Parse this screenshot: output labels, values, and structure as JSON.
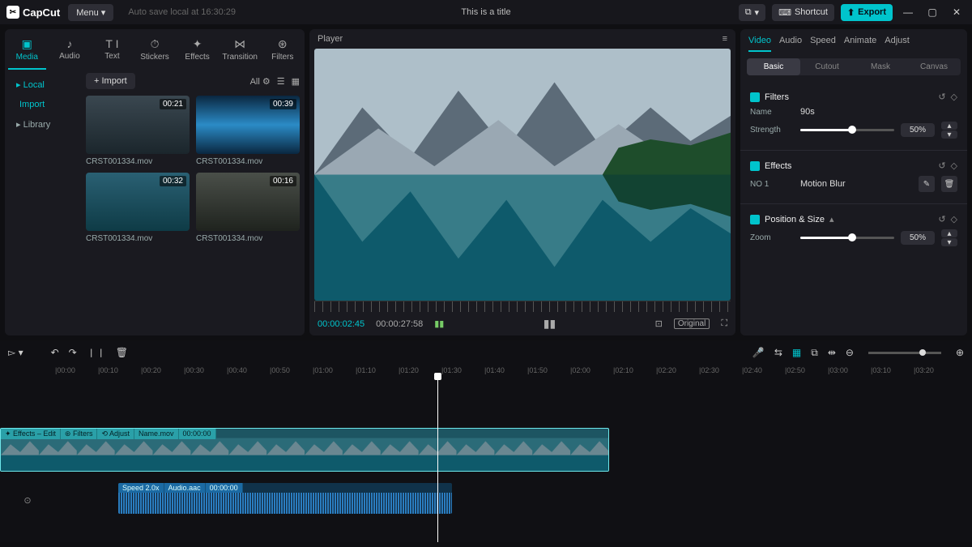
{
  "topbar": {
    "app": "CapCut",
    "menu": "Menu",
    "autosave": "Auto save local at 16:30:29",
    "title": "This is a title",
    "layout_btn": "⧉",
    "shortcut": "Shortcut",
    "export": "Export"
  },
  "tool_tabs": [
    "Media",
    "Audio",
    "Text",
    "Stickers",
    "Effects",
    "Transition",
    "Filters"
  ],
  "tool_icons": [
    "▣",
    "♪",
    "T I",
    "⏱",
    "✦",
    "⋈",
    "⊛"
  ],
  "side_nav": {
    "local": "Local",
    "import": "Import",
    "library": "Library"
  },
  "media": {
    "import": "Import",
    "filter_all": "All",
    "clips": [
      {
        "name": "CRST001334.mov",
        "dur": "00:21"
      },
      {
        "name": "CRST001334.mov",
        "dur": "00:39"
      },
      {
        "name": "CRST001334.mov",
        "dur": "00:32"
      },
      {
        "name": "CRST001334.mov",
        "dur": "00:16"
      }
    ]
  },
  "player": {
    "label": "Player",
    "current": "00:00:02:45",
    "total": "00:00:27:58",
    "original": "Original"
  },
  "inspector": {
    "tabs": [
      "Video",
      "Audio",
      "Speed",
      "Animate",
      "Adjust"
    ],
    "subtabs": [
      "Basic",
      "Cutout",
      "Mask",
      "Canvas"
    ],
    "filters": {
      "title": "Filters",
      "name_lbl": "Name",
      "name_val": "90s",
      "strength_lbl": "Strength",
      "strength_pct": "50%",
      "slider_pct": 55
    },
    "effects": {
      "title": "Effects",
      "row_no": "NO 1",
      "row_name": "Motion Blur"
    },
    "pos": {
      "title": "Position & Size",
      "zoom_lbl": "Zoom",
      "zoom_pct": "50%",
      "slider_pct": 55
    }
  },
  "timeline": {
    "marks": [
      "00:00",
      "00:10",
      "00:20",
      "00:30",
      "00:40",
      "00:50",
      "01:00",
      "01:10",
      "01:20",
      "01:30",
      "01:40",
      "01:50",
      "02:00",
      "02:10",
      "02:20",
      "02:30",
      "02:40",
      "02:50",
      "03:00",
      "03:10",
      "03:20"
    ],
    "clip_labels": [
      "✦ Effects – Edit",
      "⊛ Filters",
      "⟲ Adjust",
      "Name.mov",
      "00:00:00"
    ],
    "audio_labels": [
      "Speed 2.0x",
      "Audio.aac",
      "00:00:00"
    ]
  }
}
